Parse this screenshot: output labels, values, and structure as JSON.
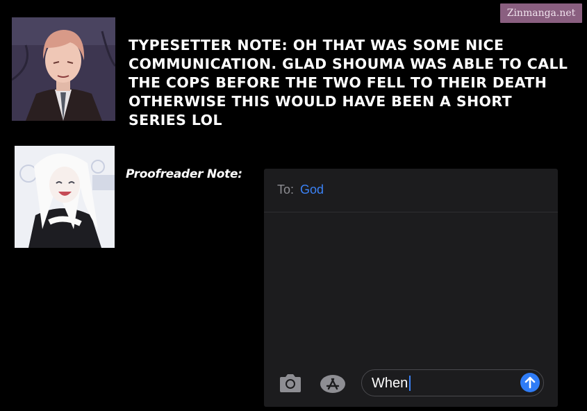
{
  "watermark": "Zinmanga.net",
  "typesetter_note": "TYPESETTER NOTE: OH THAT WAS SOME NICE COMMUNICATION. GLAD SHOUMA WAS ABLE TO CALL THE COPS BEFORE THE TWO FELL TO THEIR DEATH OTHERWISE THIS WOULD HAVE BEEN A SHORT SERIES LOL",
  "proofreader_label": "Proofreader Note:",
  "message": {
    "to_label": "To:",
    "recipient": "God",
    "draft_text": "When"
  },
  "colors": {
    "background": "#000000",
    "watermark_bg": "#8a5f80",
    "panel_bg": "#1c1c1e",
    "accent_blue": "#3b82f6"
  },
  "icons": [
    "camera-icon",
    "app-store-icon",
    "send-arrow-icon"
  ]
}
